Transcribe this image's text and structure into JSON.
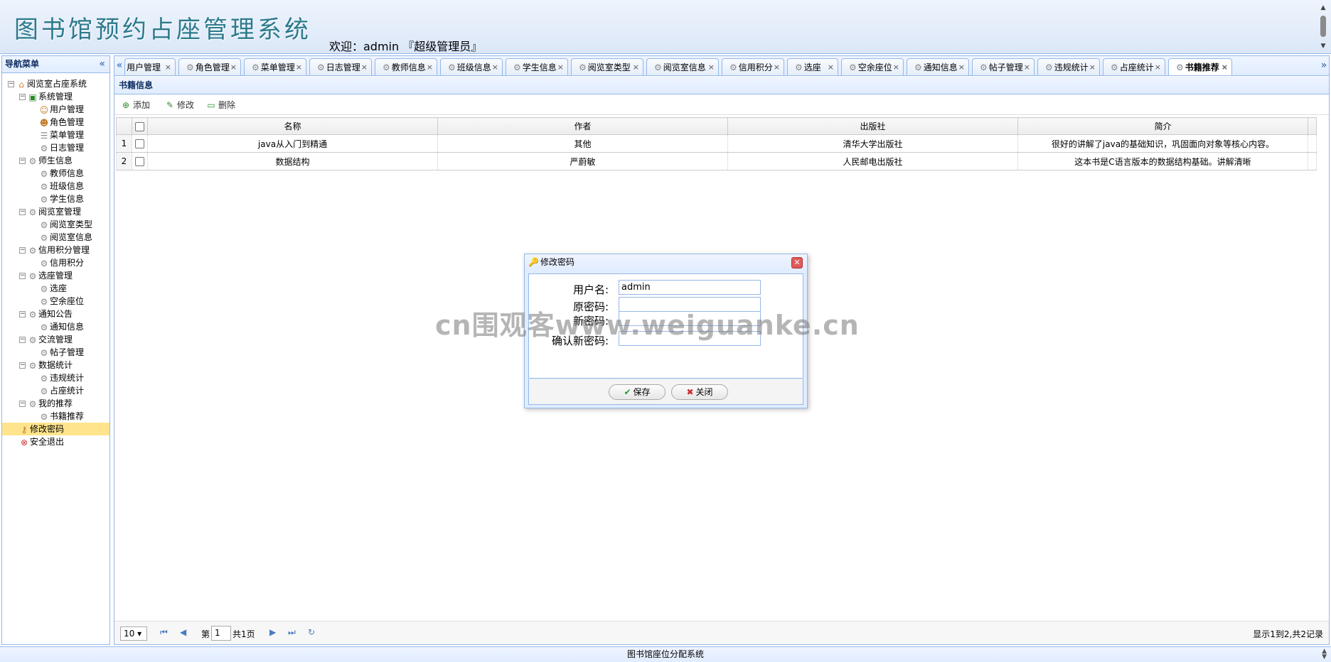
{
  "header": {
    "app_title": "图书馆预约占座管理系统",
    "welcome": "欢迎：admin 『超级管理员』"
  },
  "nav": {
    "title": "导航菜单",
    "collapse_icon": "«",
    "tree": [
      {
        "label": "阅览室占座系统",
        "level": 0,
        "toggle": "⊟",
        "icon": "home-icon"
      },
      {
        "label": "系统管理",
        "level": 1,
        "toggle": "⊟",
        "icon": "folder-icon"
      },
      {
        "label": "用户管理",
        "level": 2,
        "icon": "user-icon"
      },
      {
        "label": "角色管理",
        "level": 2,
        "icon": "role-icon"
      },
      {
        "label": "菜单管理",
        "level": 2,
        "icon": "menu-icon"
      },
      {
        "label": "日志管理",
        "level": 2,
        "icon": "gear-icon"
      },
      {
        "label": "师生信息",
        "level": 1,
        "toggle": "⊟",
        "icon": "gear-icon"
      },
      {
        "label": "教师信息",
        "level": 2,
        "icon": "gear-icon"
      },
      {
        "label": "班级信息",
        "level": 2,
        "icon": "gear-icon"
      },
      {
        "label": "学生信息",
        "level": 2,
        "icon": "gear-icon"
      },
      {
        "label": "阅览室管理",
        "level": 1,
        "toggle": "⊟",
        "icon": "gear-icon"
      },
      {
        "label": "阅览室类型",
        "level": 2,
        "icon": "gear-icon"
      },
      {
        "label": "阅览室信息",
        "level": 2,
        "icon": "gear-icon"
      },
      {
        "label": "信用积分管理",
        "level": 1,
        "toggle": "⊟",
        "icon": "gear-icon"
      },
      {
        "label": "信用积分",
        "level": 2,
        "icon": "gear-icon"
      },
      {
        "label": "选座管理",
        "level": 1,
        "toggle": "⊟",
        "icon": "gear-icon"
      },
      {
        "label": "选座",
        "level": 2,
        "icon": "gear-icon"
      },
      {
        "label": "空余座位",
        "level": 2,
        "icon": "gear-icon"
      },
      {
        "label": "通知公告",
        "level": 1,
        "toggle": "⊟",
        "icon": "gear-icon"
      },
      {
        "label": "通知信息",
        "level": 2,
        "icon": "gear-icon"
      },
      {
        "label": "交流管理",
        "level": 1,
        "toggle": "⊟",
        "icon": "gear-icon"
      },
      {
        "label": "帖子管理",
        "level": 2,
        "icon": "gear-icon"
      },
      {
        "label": "数据统计",
        "level": 1,
        "toggle": "⊟",
        "icon": "gear-icon"
      },
      {
        "label": "违规统计",
        "level": 2,
        "icon": "gear-icon"
      },
      {
        "label": "占座统计",
        "level": 2,
        "icon": "gear-icon"
      },
      {
        "label": "我的推荐",
        "level": 1,
        "toggle": "⊟",
        "icon": "gear-icon"
      },
      {
        "label": "书籍推荐",
        "level": 2,
        "icon": "gear-icon"
      },
      {
        "label": "修改密码",
        "level": 1,
        "icon": "key-icon",
        "selected": true
      },
      {
        "label": "安全退出",
        "level": 1,
        "icon": "exit-icon"
      }
    ]
  },
  "tabs": {
    "scroll_left": "«",
    "scroll_right": "»",
    "items": [
      {
        "label": "用户管理"
      },
      {
        "label": "角色管理"
      },
      {
        "label": "菜单管理"
      },
      {
        "label": "日志管理"
      },
      {
        "label": "教师信息"
      },
      {
        "label": "班级信息"
      },
      {
        "label": "学生信息"
      },
      {
        "label": "阅览室类型"
      },
      {
        "label": "阅览室信息"
      },
      {
        "label": "信用积分"
      },
      {
        "label": "选座"
      },
      {
        "label": "空余座位"
      },
      {
        "label": "通知信息"
      },
      {
        "label": "帖子管理"
      },
      {
        "label": "违规统计"
      },
      {
        "label": "占座统计"
      },
      {
        "label": "书籍推荐",
        "active": true
      }
    ]
  },
  "panel": {
    "title": "书籍信息",
    "toolbar": {
      "add": "添加",
      "edit": "修改",
      "delete": "删除"
    }
  },
  "grid": {
    "columns": [
      "名称",
      "作者",
      "出版社",
      "简介"
    ],
    "rows": [
      {
        "num": "1",
        "cells": [
          "java从入门到精通",
          "其他",
          "清华大学出版社",
          "很好的讲解了java的基础知识，巩固面向对象等核心内容。"
        ]
      },
      {
        "num": "2",
        "cells": [
          "数据结构",
          "严蔚敏",
          "人民邮电出版社",
          "这本书是C语言版本的数据结构基础。讲解清晰"
        ]
      }
    ]
  },
  "pager": {
    "page_size": "10",
    "page_prefix": "第",
    "page_value": "1",
    "page_total": "共1页",
    "summary": "显示1到2,共2记录"
  },
  "footer": {
    "text": "图书馆座位分配系统"
  },
  "dialog": {
    "title": "修改密码",
    "fields": {
      "username_label": "用户名:",
      "username_value": "admin",
      "old_password_label": "原密码:",
      "new_password_label": "新密码:",
      "confirm_password_label": "确认新密码:"
    },
    "save": "保存",
    "close": "关闭"
  },
  "watermark": "cn围观客www.weiguanke.cn",
  "colors": {
    "border": "#95b8e7",
    "header_bg": "#e0ecff",
    "selected_bg": "#ffe48d",
    "title_teal": "#2c7a8c"
  }
}
